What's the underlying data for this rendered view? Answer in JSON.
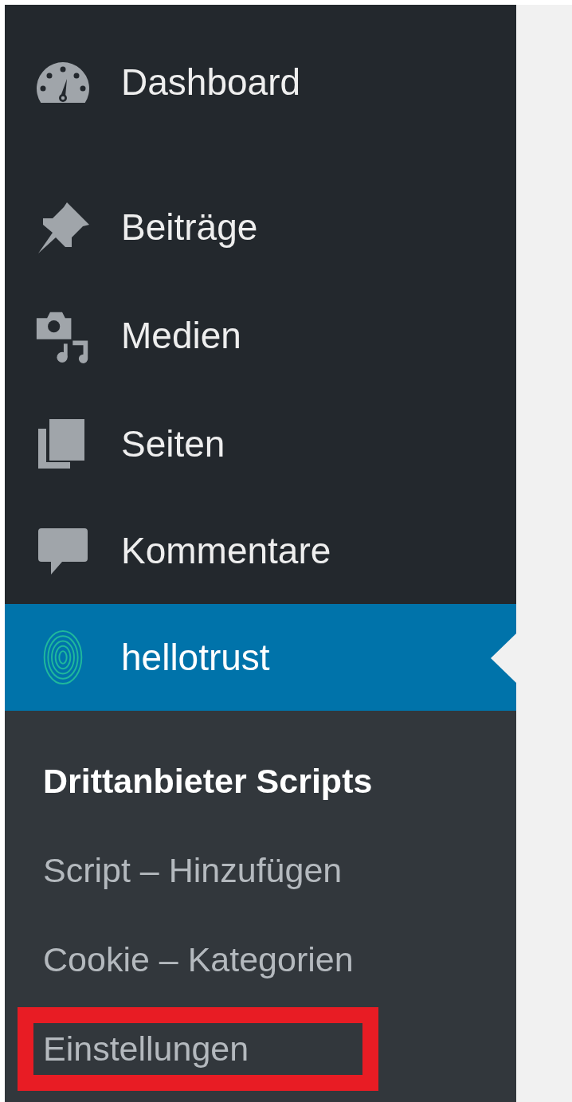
{
  "menu": [
    {
      "label": "Dashboard",
      "selected": false
    },
    {
      "label": "Beiträge",
      "selected": false
    },
    {
      "label": "Medien",
      "selected": false
    },
    {
      "label": "Seiten",
      "selected": false
    },
    {
      "label": "Kommentare",
      "selected": false
    },
    {
      "label": "hellotrust",
      "selected": true
    }
  ],
  "submenu": [
    {
      "label": "Drittanbieter Scripts",
      "selected": true,
      "highlighted": false
    },
    {
      "label": "Script – Hinzufügen",
      "selected": false,
      "highlighted": false
    },
    {
      "label": "Cookie – Kategorien",
      "selected": false,
      "highlighted": false
    },
    {
      "label": "Einstellungen",
      "selected": false,
      "highlighted": true
    }
  ]
}
